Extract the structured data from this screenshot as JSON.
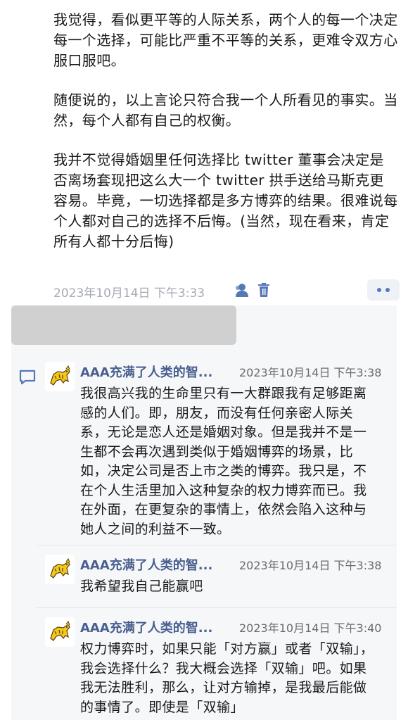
{
  "post": {
    "paragraphs": [
      "我觉得，看似更平等的人际关系，两个人的每一个决定每一个选择，可能比严重不平等的关系，更难令双方心服口服吧。",
      "随便说的，以上言论只符合我一个人所看见的事实。当然，每个人都有自己的权衡。",
      "我并不觉得婚姻里任何选择比 twitter 董事会决定是否离场套现把这么大一个 twitter 拱手送给马斯克更容易。毕竟，一切选择都是多方博弈的结果。很难说每个人都对自己的选择不后悔。(当然，现在看来，肯定所有人都十分后悔)"
    ],
    "timestamp": "2023年10月14日 下午3:33",
    "icons": [
      "user-icon",
      "trash-icon",
      "more-icon"
    ]
  },
  "comments": [
    {
      "author": "AAA充满了人类的智...",
      "time": "2023年10月14日 下午3:38",
      "text": "我很高兴我的生命里只有一大群跟我有足够距离感的人们。即，朋友，而没有任何亲密人际关系，无论是恋人还是婚姻对象。但是我并不是一生都不会再次遇到类似于婚姻博弈的场景，比如，决定公司是否上市之类的博弈。我只是，不在个人生活里加入这种复杂的权力博弈而已。我在外面，在更复杂的事情上，依然会陷入这种与她人之间的利益不一致。"
    },
    {
      "author": "AAA充满了人类的智...",
      "time": "2023年10月14日 下午3:38",
      "text": "我希望我自己能赢吧"
    },
    {
      "author": "AAA充满了人类的智...",
      "time": "2023年10月14日 下午3:40",
      "text": "权力博弈时，如果只能「对方赢」或者「双输」，我会选择什么？我大概会选择「双输」吧。如果我无法胜利，那么，让对方输掉，是我最后能做的事情了。即使是「双输」"
    }
  ],
  "colors": {
    "accent": "#485f8f",
    "icon_blue": "#5578b8",
    "meta_gray": "#a4a9b2",
    "comment_bg": "#f6f7f9"
  }
}
